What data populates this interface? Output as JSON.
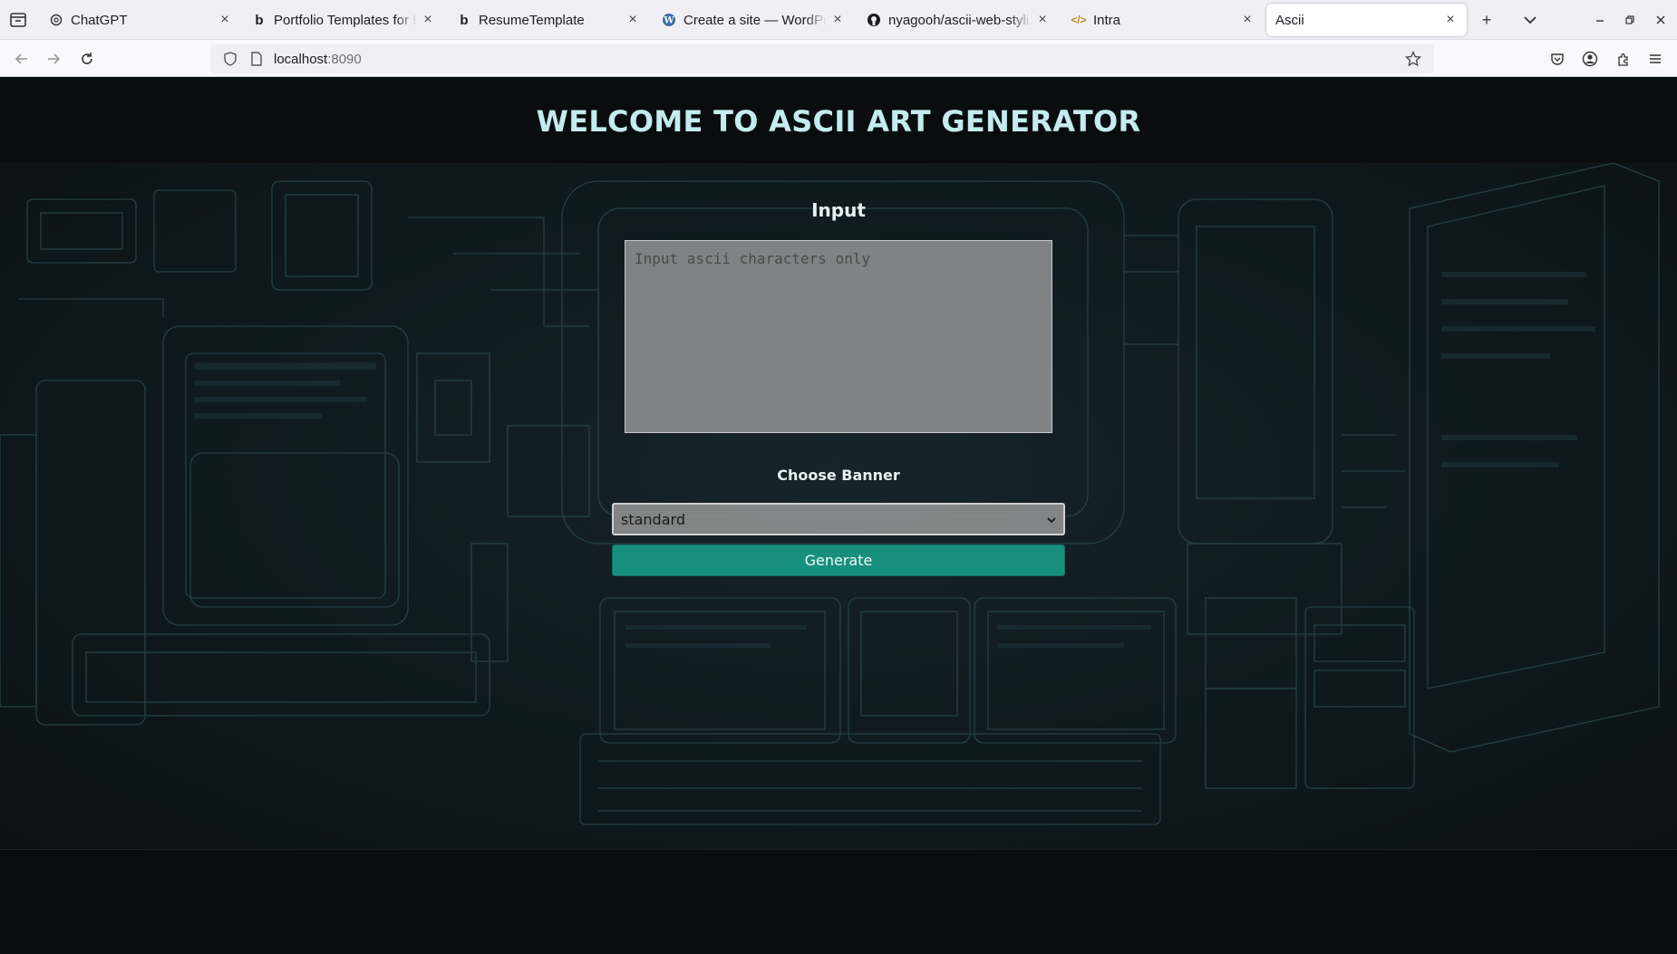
{
  "browser": {
    "tabs": [
      {
        "title": "ChatGPT",
        "icon": "chatgpt-icon"
      },
      {
        "title": "Portfolio Templates for B",
        "icon": "bootstrap-icon"
      },
      {
        "title": "ResumeTemplate",
        "icon": "bootstrap-icon"
      },
      {
        "title": "Create a site — WordPre",
        "icon": "wordpress-icon"
      },
      {
        "title": "nyagooh/ascii-web-styliz",
        "icon": "github-icon"
      },
      {
        "title": "Intra",
        "icon": "code-icon"
      },
      {
        "title": "Ascii",
        "icon": ""
      }
    ],
    "active_tab_index": 6,
    "url_host": "localhost",
    "url_port": ":8090"
  },
  "page": {
    "title": "WELCOME TO ASCII ART GENERATOR",
    "input_label": "Input",
    "input_placeholder": "Input ascii characters only",
    "input_value": "",
    "banner_label": "Choose Banner",
    "banner_selected": "standard",
    "generate_label": "Generate"
  },
  "colors": {
    "title": "#c4ecef",
    "generate_button": "#178f7d",
    "page_background": "#0a0d0f"
  }
}
